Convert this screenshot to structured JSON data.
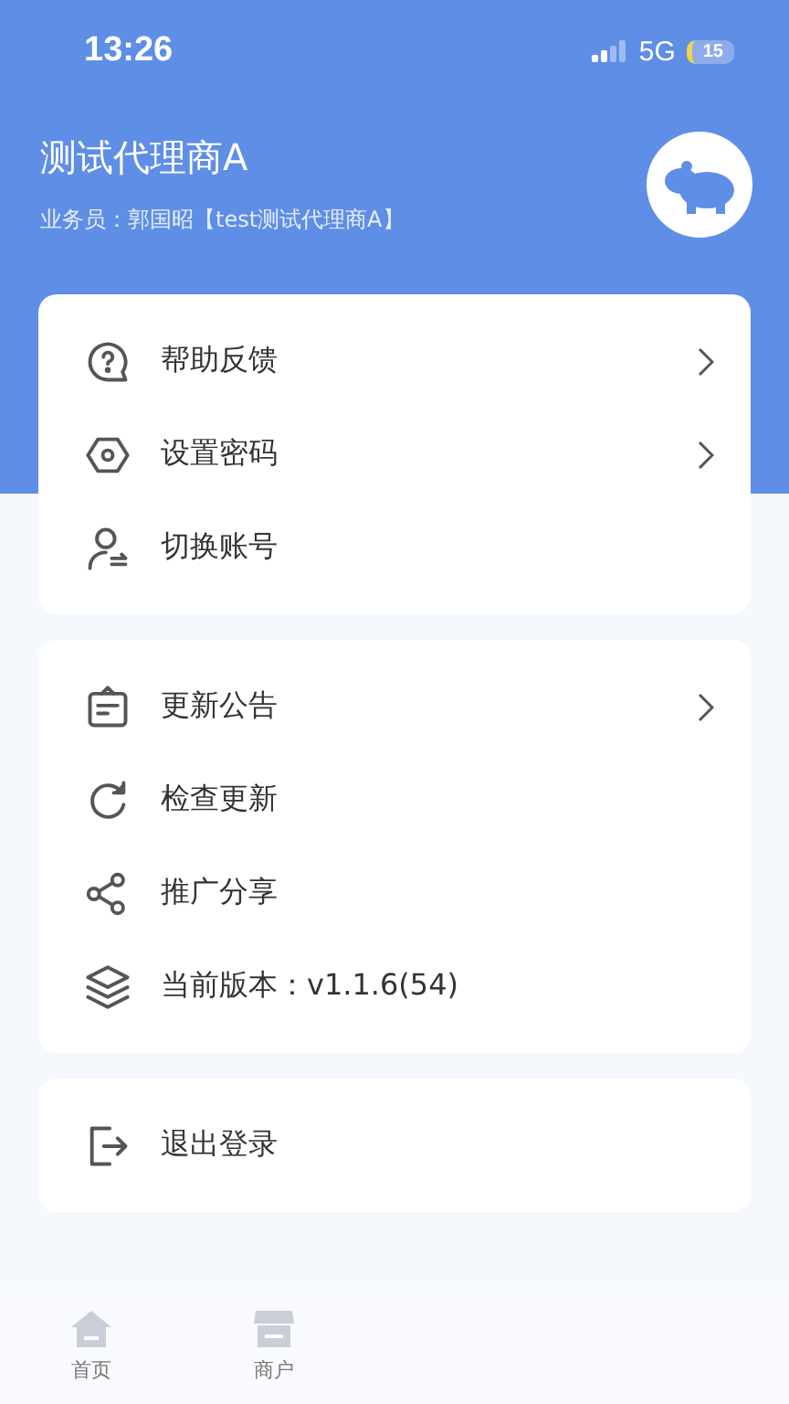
{
  "status_bar": {
    "time": "13:26",
    "network": "5G",
    "battery": "15"
  },
  "profile": {
    "name": "测试代理商A",
    "subtitle": "业务员：郭国昭【test测试代理商A】"
  },
  "menu_groups": [
    {
      "items": [
        {
          "kind": "help",
          "label": "帮助反馈",
          "arrow": true
        },
        {
          "kind": "password",
          "label": "设置密码",
          "arrow": true
        },
        {
          "kind": "switch",
          "label": "切换账号",
          "arrow": false
        }
      ]
    },
    {
      "items": [
        {
          "kind": "notice",
          "label": "更新公告",
          "arrow": true
        },
        {
          "kind": "update",
          "label": "检查更新",
          "arrow": false
        },
        {
          "kind": "share",
          "label": "推广分享",
          "arrow": false
        },
        {
          "kind": "version",
          "label": "当前版本：v1.1.6(54)",
          "arrow": false
        }
      ]
    },
    {
      "items": [
        {
          "kind": "logout",
          "label": "退出登录",
          "arrow": false
        }
      ]
    }
  ],
  "tab_bar": [
    {
      "kind": "home",
      "label": "首页",
      "selected": false
    },
    {
      "kind": "shop",
      "label": "商户",
      "selected": false
    }
  ]
}
